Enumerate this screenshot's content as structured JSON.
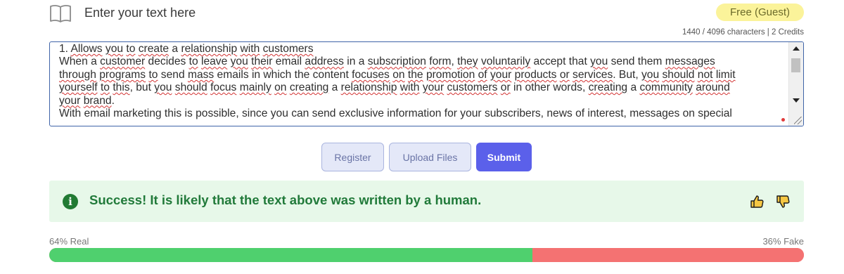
{
  "header": {
    "title": "Enter your text here",
    "badge": "Free (Guest)",
    "icon": "book-icon"
  },
  "counter": "1440 / 4096 characters | 2 Credits",
  "textarea": {
    "segments": [
      {
        "t": "1. "
      },
      {
        "t": "Allows",
        "s": 1
      },
      {
        "t": " "
      },
      {
        "t": "you",
        "s": 1
      },
      {
        "t": " "
      },
      {
        "t": "to",
        "s": 1
      },
      {
        "t": " "
      },
      {
        "t": "create",
        "s": 1
      },
      {
        "t": " a "
      },
      {
        "t": "relationship",
        "s": 1
      },
      {
        "t": " "
      },
      {
        "t": "with",
        "s": 1
      },
      {
        "t": " "
      },
      {
        "t": "customers",
        "s": 1
      },
      {
        "t": "\n"
      },
      {
        "t": "When a "
      },
      {
        "t": "customer",
        "s": 1
      },
      {
        "t": " decides "
      },
      {
        "t": "to",
        "s": 1
      },
      {
        "t": " "
      },
      {
        "t": "leave",
        "s": 1
      },
      {
        "t": " "
      },
      {
        "t": "you",
        "s": 1
      },
      {
        "t": " "
      },
      {
        "t": "their",
        "s": 1
      },
      {
        "t": " email "
      },
      {
        "t": "address",
        "s": 1
      },
      {
        "t": " in a "
      },
      {
        "t": "subscription",
        "s": 1
      },
      {
        "t": " "
      },
      {
        "t": "form",
        "s": 1
      },
      {
        "t": ", "
      },
      {
        "t": "they",
        "s": 1
      },
      {
        "t": " "
      },
      {
        "t": "voluntarily",
        "s": 1
      },
      {
        "t": " accept that "
      },
      {
        "t": "you",
        "s": 1
      },
      {
        "t": " send them "
      },
      {
        "t": "messages",
        "s": 1
      },
      {
        "t": "\n"
      },
      {
        "t": "through",
        "s": 1
      },
      {
        "t": " "
      },
      {
        "t": "programs",
        "s": 1
      },
      {
        "t": " "
      },
      {
        "t": "to",
        "s": 1
      },
      {
        "t": " send "
      },
      {
        "t": "mass",
        "s": 1
      },
      {
        "t": " emails in which the content "
      },
      {
        "t": "focuses",
        "s": 1
      },
      {
        "t": " "
      },
      {
        "t": "on",
        "s": 1
      },
      {
        "t": " "
      },
      {
        "t": "the",
        "s": 1
      },
      {
        "t": " "
      },
      {
        "t": "promotion",
        "s": 1
      },
      {
        "t": " "
      },
      {
        "t": "of",
        "s": 1
      },
      {
        "t": " "
      },
      {
        "t": "your",
        "s": 1
      },
      {
        "t": " "
      },
      {
        "t": "products",
        "s": 1
      },
      {
        "t": " "
      },
      {
        "t": "or",
        "s": 1
      },
      {
        "t": " "
      },
      {
        "t": "services",
        "s": 1
      },
      {
        "t": ". But, "
      },
      {
        "t": "you",
        "s": 1
      },
      {
        "t": " "
      },
      {
        "t": "should",
        "s": 1
      },
      {
        "t": " "
      },
      {
        "t": "not",
        "s": 1
      },
      {
        "t": " "
      },
      {
        "t": "limit",
        "s": 1
      },
      {
        "t": "\n"
      },
      {
        "t": "yourself",
        "s": 1
      },
      {
        "t": " "
      },
      {
        "t": "to",
        "s": 1
      },
      {
        "t": " "
      },
      {
        "t": "this",
        "s": 1
      },
      {
        "t": ", but "
      },
      {
        "t": "you",
        "s": 1
      },
      {
        "t": " "
      },
      {
        "t": "should",
        "s": 1
      },
      {
        "t": " "
      },
      {
        "t": "focus",
        "s": 1
      },
      {
        "t": " "
      },
      {
        "t": "mainly",
        "s": 1
      },
      {
        "t": " "
      },
      {
        "t": "on",
        "s": 1
      },
      {
        "t": " "
      },
      {
        "t": "creating",
        "s": 1
      },
      {
        "t": " a "
      },
      {
        "t": "relationship",
        "s": 1
      },
      {
        "t": " "
      },
      {
        "t": "with",
        "s": 1
      },
      {
        "t": " "
      },
      {
        "t": "your",
        "s": 1
      },
      {
        "t": " "
      },
      {
        "t": "customers",
        "s": 1
      },
      {
        "t": " "
      },
      {
        "t": "or",
        "s": 1
      },
      {
        "t": " in other words, "
      },
      {
        "t": "creating",
        "s": 1
      },
      {
        "t": " a "
      },
      {
        "t": "community",
        "s": 1
      },
      {
        "t": " "
      },
      {
        "t": "around",
        "s": 1
      },
      {
        "t": "\n"
      },
      {
        "t": "your",
        "s": 1
      },
      {
        "t": " "
      },
      {
        "t": "brand",
        "s": 1
      },
      {
        "t": ".\n"
      },
      {
        "t": "With email marketing this is possible, since you can send exclusive information for your subscribers, news of interest, messages on special"
      }
    ]
  },
  "buttons": {
    "register": "Register",
    "upload": "Upload Files",
    "submit": "Submit"
  },
  "alert": {
    "icon": "info-icon",
    "icon_glyph": "i",
    "message": "Success! It is likely that the text above was written by a human.",
    "thumb_up_icon": "thumbs-up-icon",
    "thumb_down_icon": "thumbs-down-icon"
  },
  "result": {
    "real_label": "64% Real",
    "fake_label": "36% Fake",
    "real_percent": 64,
    "fake_percent": 36
  },
  "colors": {
    "accent": "#5b60ea",
    "success_text": "#217a3a",
    "success_bg": "#e7f8e9",
    "real_bar": "#4fd06e",
    "fake_bar": "#f47272",
    "badge_bg": "#fbf39a"
  }
}
